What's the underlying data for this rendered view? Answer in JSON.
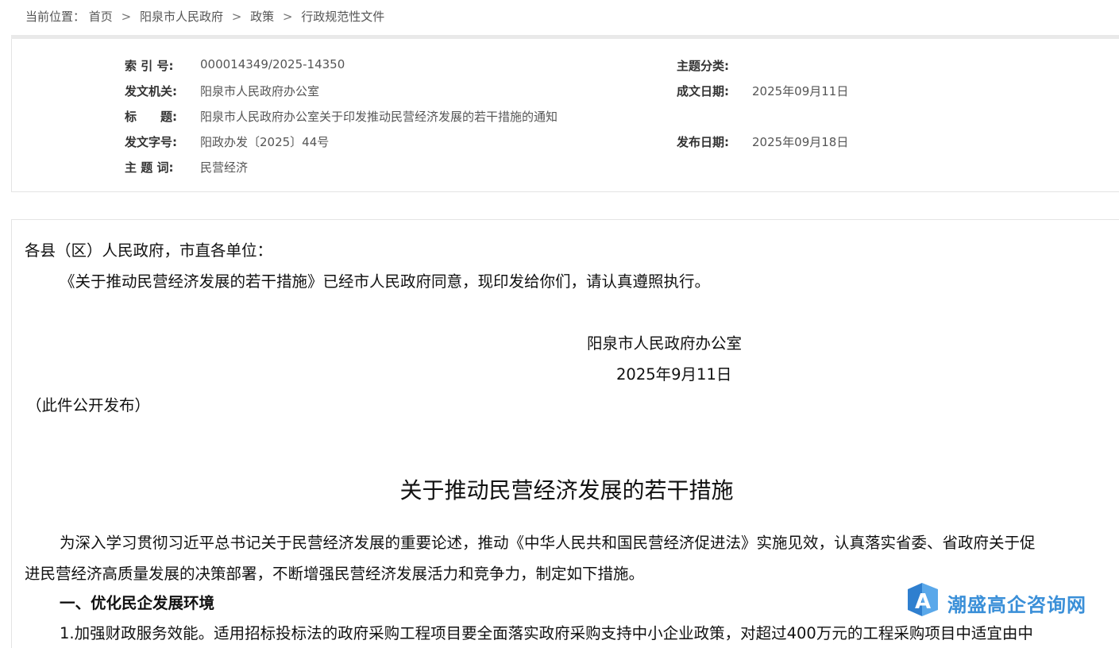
{
  "breadcrumb": {
    "prefix": "当前位置：",
    "items": [
      "首页",
      "阳泉市人民政府",
      "政策",
      "行政规范性文件"
    ],
    "separator": ">"
  },
  "meta": {
    "index_label": "索 引 号:",
    "index_value": "000014349/2025-14350",
    "category_label": "主题分类:",
    "category_value": "",
    "issuer_label": "发文机关:",
    "issuer_value": "阳泉市人民政府办公室",
    "written_label": "成文日期:",
    "written_value": "2025年09月11日",
    "title_label": "标　　题:",
    "title_value": "阳泉市人民政府办公室关于印发推动民营经济发展的若干措施的通知",
    "docno_label": "发文字号:",
    "docno_value": "阳政办发〔2025〕44号",
    "published_label": "发布日期:",
    "published_value": "2025年09月18日",
    "keywords_label": "主 题 词:",
    "keywords_value": "民营经济"
  },
  "body": {
    "salutation": "各县（区）人民政府，市直各单位：",
    "notice": "《关于推动民营经济发展的若干措施》已经市人民政府同意，现印发给你们，请认真遵照执行。",
    "sign_org": "阳泉市人民政府办公室",
    "sign_date": "2025年9月11日",
    "disclosure": "（此件公开发布）",
    "doc_title": "关于推动民营经济发展的若干措施",
    "intro_line1": "为深入学习贯彻习近平总书记关于民营经济发展的重要论述，推动《中华人民共和国民营经济促进法》实施见效，认真落实省委、省政府关于促",
    "intro_line2": "进民营经济高质量发展的决策部署，不断增强民营经济发展活力和竞争力，制定如下措施。",
    "section1": "一、优化民企发展环境",
    "item1_partial": "1.加强财政服务效能。适用招标投标法的政府采购工程项目要全面落实政府采购支持中小企业政策，对超过400万元的工程采购项目中适宜由中"
  },
  "watermark": {
    "text": "潮盛高企咨询网",
    "color": "#3a8fd8"
  }
}
